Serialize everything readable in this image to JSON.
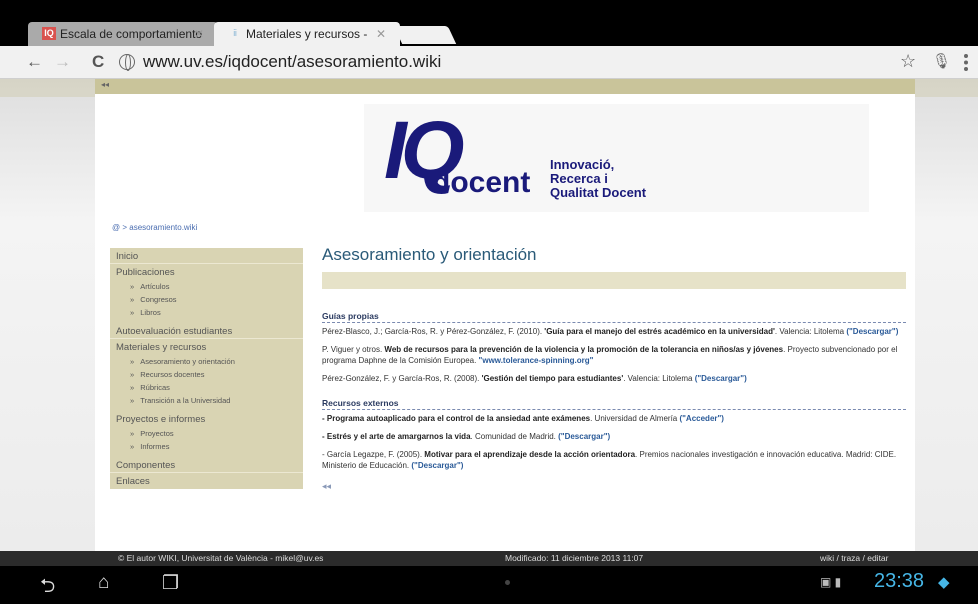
{
  "tabs": [
    {
      "label": "Escala de comportamiento",
      "icon": "IQ"
    },
    {
      "label": "Materiales y recursos -",
      "icon": "ⅱ"
    }
  ],
  "url": "www.uv.es/iqdocent/asesoramiento.wiki",
  "header": {
    "top_strip": "◂◂"
  },
  "logo": {
    "mark": "IQ",
    "word": "docent",
    "tagline": "Innovació,\nRecerca i\nQualitat Docent"
  },
  "breadcrumb": "@ > asesoramiento.wiki",
  "sidebar": {
    "inicio": "Inicio",
    "publicaciones": "Publicaciones",
    "publicaciones_items": [
      "Artículos",
      "Congresos",
      "Libros"
    ],
    "autoevaluacion": "Autoevaluación estudiantes",
    "materiales": "Materiales y recursos",
    "materiales_items": [
      "Asesoramiento y orientación",
      "Recursos docentes",
      "Rúbricas",
      "Transición a la Universidad"
    ],
    "proyectos": "Proyectos e informes",
    "proyectos_items": [
      "Proyectos",
      "Informes"
    ],
    "componentes": "Componentes",
    "enlaces": "Enlaces"
  },
  "main": {
    "title": "Asesoramiento y orientación",
    "sec1": "Guías propias",
    "r1a": "Pérez-Blasco, J.; García-Ros, R. y Pérez-González, F. (2010). ",
    "r1b": "'Guía para el manejo del estrés académico en la universidad'",
    "r1c": ". Valencia: Litolema ",
    "r1d": "(\"Descargar\")",
    "r2a": "P. Viguer y otros. ",
    "r2b": "Web de recursos para la prevención de la violencia y la promoción de la tolerancia en niños/as y jóvenes",
    "r2c": ". Proyecto subvencionado por el programa Daphne de la Comisión Europea. ",
    "r2d": "\"www.tolerance-spinning.org\"",
    "r3a": "Pérez-González, F. y García-Ros, R. (2008). ",
    "r3b": "'Gestión del tiempo para estudiantes'",
    "r3c": ". Valencia: Litolema ",
    "r3d": "(\"Descargar\")",
    "sec2": "Recursos externos",
    "e1a": "- Programa autoaplicado para el control de la ansiedad ante exámenes",
    "e1b": ". Universidad de Almería ",
    "e1c": "(\"Acceder\")",
    "e2a": "- Estrés y el arte de amargarnos la vida",
    "e2b": ". Comunidad de Madrid. ",
    "e2c": "(\"Descargar\")",
    "e3a": "- García Legazpe, F. (2005). ",
    "e3b": "Motivar para el aprendizaje desde la acción orientadora",
    "e3c": ". Premios nacionales investigación e innovación educativa. Madrid: CIDE. Ministerio de Educación. ",
    "e3d": "(\"Descargar\")",
    "back": "◂◂"
  },
  "footer": {
    "left": "© El autor WIKI, Universitat de València  -  mikel@uv.es",
    "mid": "Modificado: 11 diciembre 2013 11:07",
    "right": "wiki / traza / editar"
  },
  "status": {
    "time": "23:38"
  }
}
